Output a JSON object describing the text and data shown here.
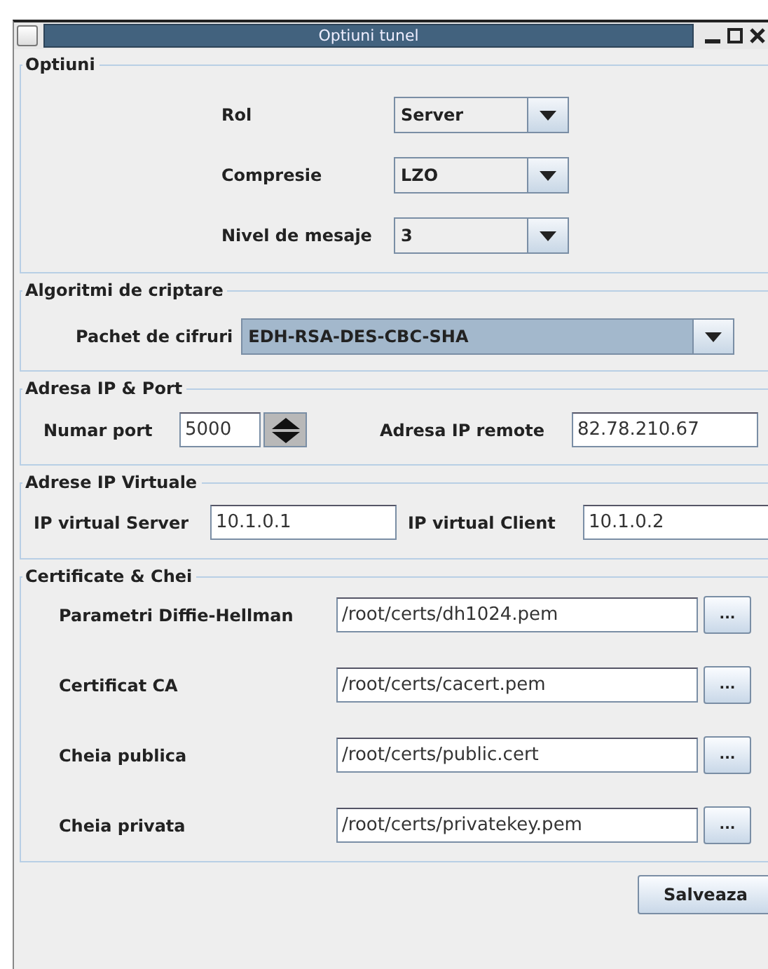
{
  "window": {
    "title": "Optiuni tunel"
  },
  "options": {
    "title": "Optiuni",
    "rows": [
      {
        "label": "Rol",
        "value": "Server",
        "focused": false
      },
      {
        "label": "Compresie",
        "value": "LZO",
        "focused": false
      },
      {
        "label": "Nivel de mesaje",
        "value": "3",
        "focused": false
      }
    ]
  },
  "encryption": {
    "title": "Algoritmi de criptare",
    "label": "Pachet de cifruri",
    "value": "EDH-RSA-DES-CBC-SHA",
    "focused": true
  },
  "address": {
    "title": "Adresa IP & Port",
    "port_label": "Numar port",
    "port": "5000",
    "remote_label": "Adresa IP remote",
    "remote": "82.78.210.67"
  },
  "virtual": {
    "title": "Adrese IP Virtuale",
    "server_label": "IP virtual Server",
    "server": "10.1.0.1",
    "client_label": "IP virtual Client",
    "client": "10.1.0.2"
  },
  "certificates": {
    "title": "Certificate & Chei",
    "rows": [
      {
        "label": "Parametri Diffie-Hellman",
        "value": "/root/certs/dh1024.pem",
        "button": "..."
      },
      {
        "label": "Certificat CA",
        "value": "/root/certs/cacert.pem",
        "button": "..."
      },
      {
        "label": "Cheia publica",
        "value": "/root/certs/public.cert",
        "button": "..."
      },
      {
        "label": "Cheia privata",
        "value": "/root/certs/privatekey.pem",
        "button": "..."
      }
    ]
  },
  "save_button": "Salveaza"
}
